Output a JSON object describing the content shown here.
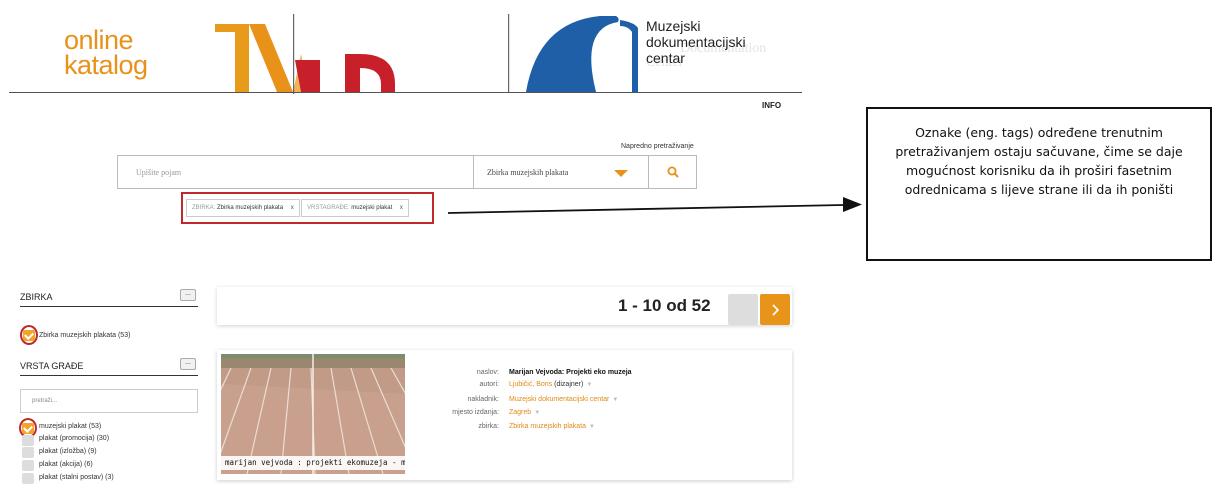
{
  "header": {
    "logo_line1": "online",
    "logo_line2": "katalog",
    "institution_line1": "Muzejski",
    "institution_line2": "dokumentacijski",
    "institution_line3": "centar",
    "institution_ghost_line1": "Documentation",
    "institution_ghost_line2": "Center",
    "info_link": "INFO"
  },
  "search": {
    "advanced_link": "Napredno pretraživanje",
    "placeholder": "Upišite pojam",
    "collection_select": "Zbirka muzejskih plakata",
    "tags": [
      {
        "key": "ZBIRKA:",
        "value": "Zbirka muzejskih plakata",
        "remove": "x"
      },
      {
        "key": "VRSTAGRAĐE:",
        "value": "muzejski plakat",
        "remove": "x"
      }
    ]
  },
  "callout": {
    "text": "Oznake (eng. tags) određene trenutnim pretraživanjem ostaju sačuvane, čime se daje mogućnost korisniku da ih proširi fasetnim odrednicama s lijeve strane ili da ih poništi"
  },
  "sidebar": {
    "facet1": {
      "title": "ZBIRKA",
      "more": "...",
      "items": [
        {
          "label": "Zbirka muzejskih plakata (53)",
          "checked": true
        }
      ]
    },
    "facet2": {
      "title": "VRSTA GRAĐE",
      "more": "...",
      "filter_placeholder": "pretraži...",
      "items": [
        {
          "label": "muzejski plakat (53)",
          "checked": true
        },
        {
          "label": "plakat (promocija) (30)",
          "checked": false
        },
        {
          "label": "plakat (izložba) (9)",
          "checked": false
        },
        {
          "label": "plakat (akcija) (6)",
          "checked": false
        },
        {
          "label": "plakat (stalni postav) (3)",
          "checked": false
        }
      ]
    }
  },
  "results": {
    "count_text": "1 - 10 od 52",
    "next_icon": "chevron-right-icon",
    "item": {
      "thumbnail_caption": "marijan vejvoda : projekti ekomuzeja  - mdc",
      "labels": {
        "title": "naslov:",
        "authors": "autori:",
        "publisher": "nakladnik:",
        "place": "mjesto izdanja:",
        "collection": "zbirka:"
      },
      "title": "Marijan Vejvoda: Projekti eko muzeja",
      "author_name": "Ljubičić, Boris",
      "author_role": "(dizajner)",
      "publisher": "Muzejski dokumentacijski centar",
      "place": "Zagreb",
      "collection": "Zbirka muzejskih plakata"
    }
  },
  "colors": {
    "accent_orange": "#e8941b",
    "highlight_red": "#c0282d",
    "logo_red": "#c8202a",
    "logo_blue": "#1f5fa8"
  }
}
